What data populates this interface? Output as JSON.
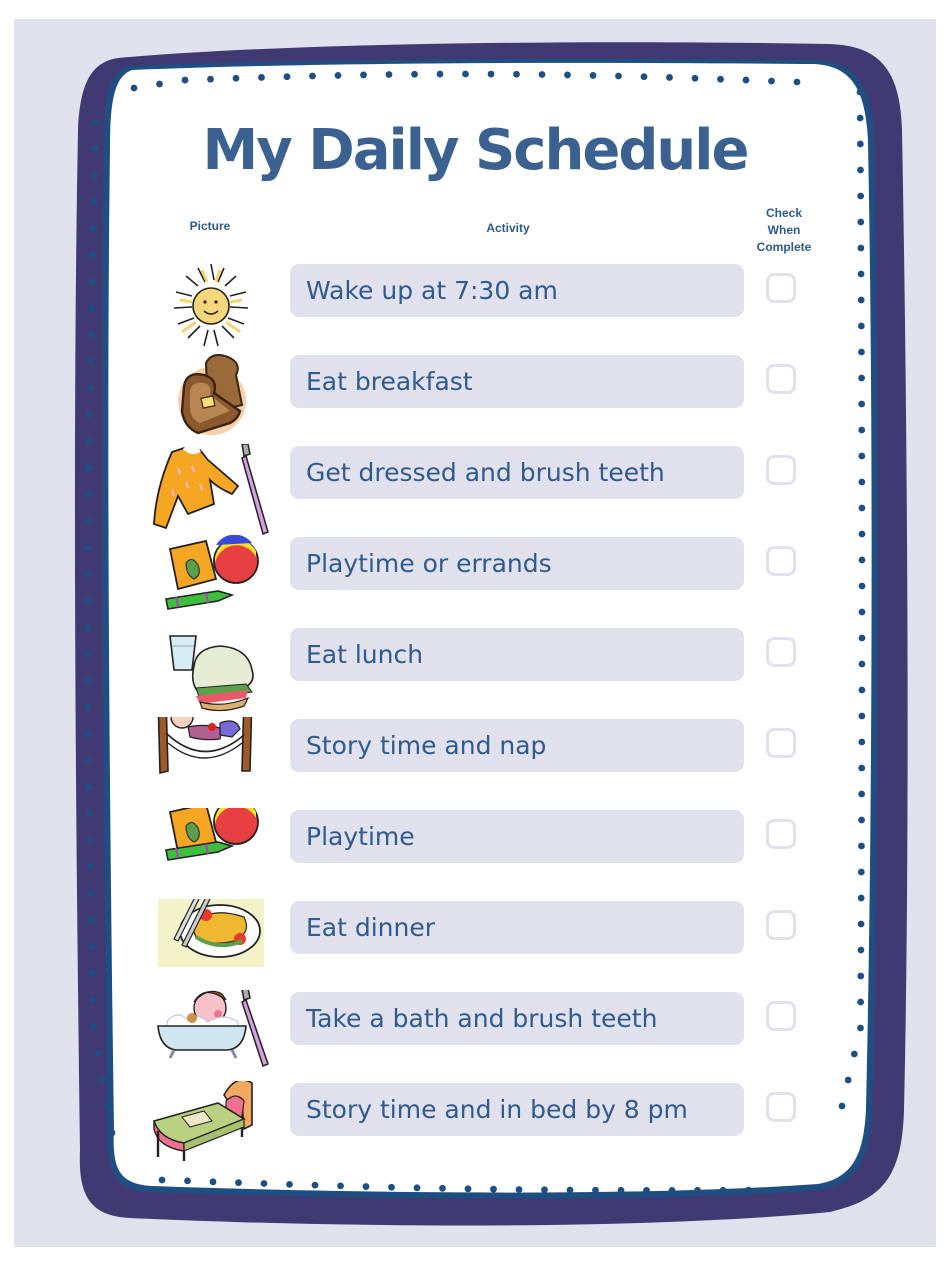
{
  "document": {
    "title": "My Daily Schedule",
    "colors": {
      "background_panel": "#e1e1ee",
      "frame_border": "#413a72",
      "frame_inner_line": "#1f4e82",
      "dots": "#1f4e82",
      "title_text": "#3b6190",
      "activity_box": "#e1e1ee",
      "activity_text": "#2f5a8c"
    }
  },
  "headers": {
    "picture": "Picture",
    "activity": "Activity",
    "check_line1": "Check",
    "check_line2": "When",
    "check_line3": "Complete"
  },
  "rows": [
    {
      "picture": "sun-icon",
      "activity": "Wake up at 7:30 am",
      "checked": false
    },
    {
      "picture": "toast-icon",
      "activity": "Eat breakfast",
      "checked": false
    },
    {
      "picture": "shirt-and-toothbrush-icon",
      "activity": "Get dressed and brush teeth",
      "checked": false
    },
    {
      "picture": "toys-icon",
      "activity": "Playtime or errands",
      "checked": false
    },
    {
      "picture": "sandwich-and-water-icon",
      "activity": "Eat lunch",
      "checked": false
    },
    {
      "picture": "child-in-hammock-icon",
      "activity": "Story time and nap",
      "checked": false
    },
    {
      "picture": "toys-icon",
      "activity": "Playtime",
      "checked": false
    },
    {
      "picture": "dinner-plate-icon",
      "activity": "Eat dinner",
      "checked": false
    },
    {
      "picture": "bath-and-toothbrush-icon",
      "activity": "Take a bath and brush teeth",
      "checked": false
    },
    {
      "picture": "bed-icon",
      "activity": "Story time and in bed by 8 pm",
      "checked": false
    }
  ]
}
